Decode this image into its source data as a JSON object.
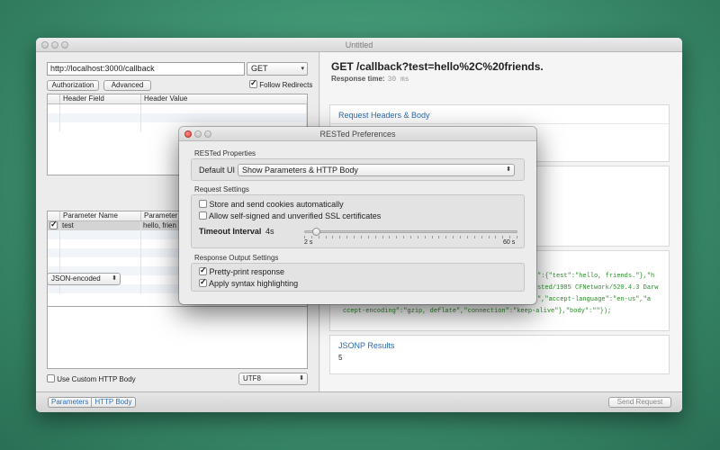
{
  "window": {
    "title": "Untitled"
  },
  "request": {
    "url": "http://localhost:3000/callback",
    "method": "GET",
    "authorization_label": "Authorization",
    "advanced_label": "Advanced",
    "follow_redirects_label": "Follow Redirects",
    "follow_redirects_checked": true,
    "header_columns": [
      "Header Field",
      "Header Value"
    ],
    "param_columns": [
      "Parameter Name",
      "Parameter V"
    ],
    "params": [
      {
        "checked": true,
        "name": "test",
        "value": "hello, frien"
      }
    ],
    "encoding": "JSON-encoded",
    "use_custom_body_label": "Use Custom HTTP Body",
    "charset": "UTF8"
  },
  "bottombar": {
    "tabs": [
      "Parameters",
      "HTTP Body"
    ],
    "send_label": "Send Request"
  },
  "response": {
    "title": "GET /callback?test=hello%2C%20friends.",
    "time_label": "Response time:",
    "time_value": "30 ms",
    "headers_card_title": "Request Headers & Body",
    "code_lines": [
      "\":{\"test\":\"hello, friends.\"},\"h",
      "sted/1985 CFNetwork/520.4.3 Darw",
      "\",\"accept-language\":\"en-us\",\"a",
      "ccept-encoding\":\"gzip, deflate\",\"connection\":\"keep-alive\"},\"body\":\"\"});"
    ],
    "jsonp_title": "JSONP Results",
    "jsonp_value": "5"
  },
  "preferences": {
    "title": "RESTed Preferences",
    "properties_label": "RESTed Properties",
    "default_ui_label": "Default UI",
    "default_ui_value": "Show Parameters & HTTP Body",
    "request_settings_label": "Request Settings",
    "store_cookies_label": "Store and send cookies automatically",
    "store_cookies_checked": false,
    "allow_ssl_label": "Allow self-signed and unverified SSL certificates",
    "allow_ssl_checked": false,
    "timeout_label": "Timeout Interval",
    "timeout_value": "4s",
    "timeout_fraction": 0.04,
    "timeout_min": "2 s",
    "timeout_max": "60 s",
    "output_settings_label": "Response Output Settings",
    "pretty_print_label": "Pretty-print response",
    "pretty_print_checked": true,
    "syntax_label": "Apply syntax highlighting",
    "syntax_checked": true
  }
}
